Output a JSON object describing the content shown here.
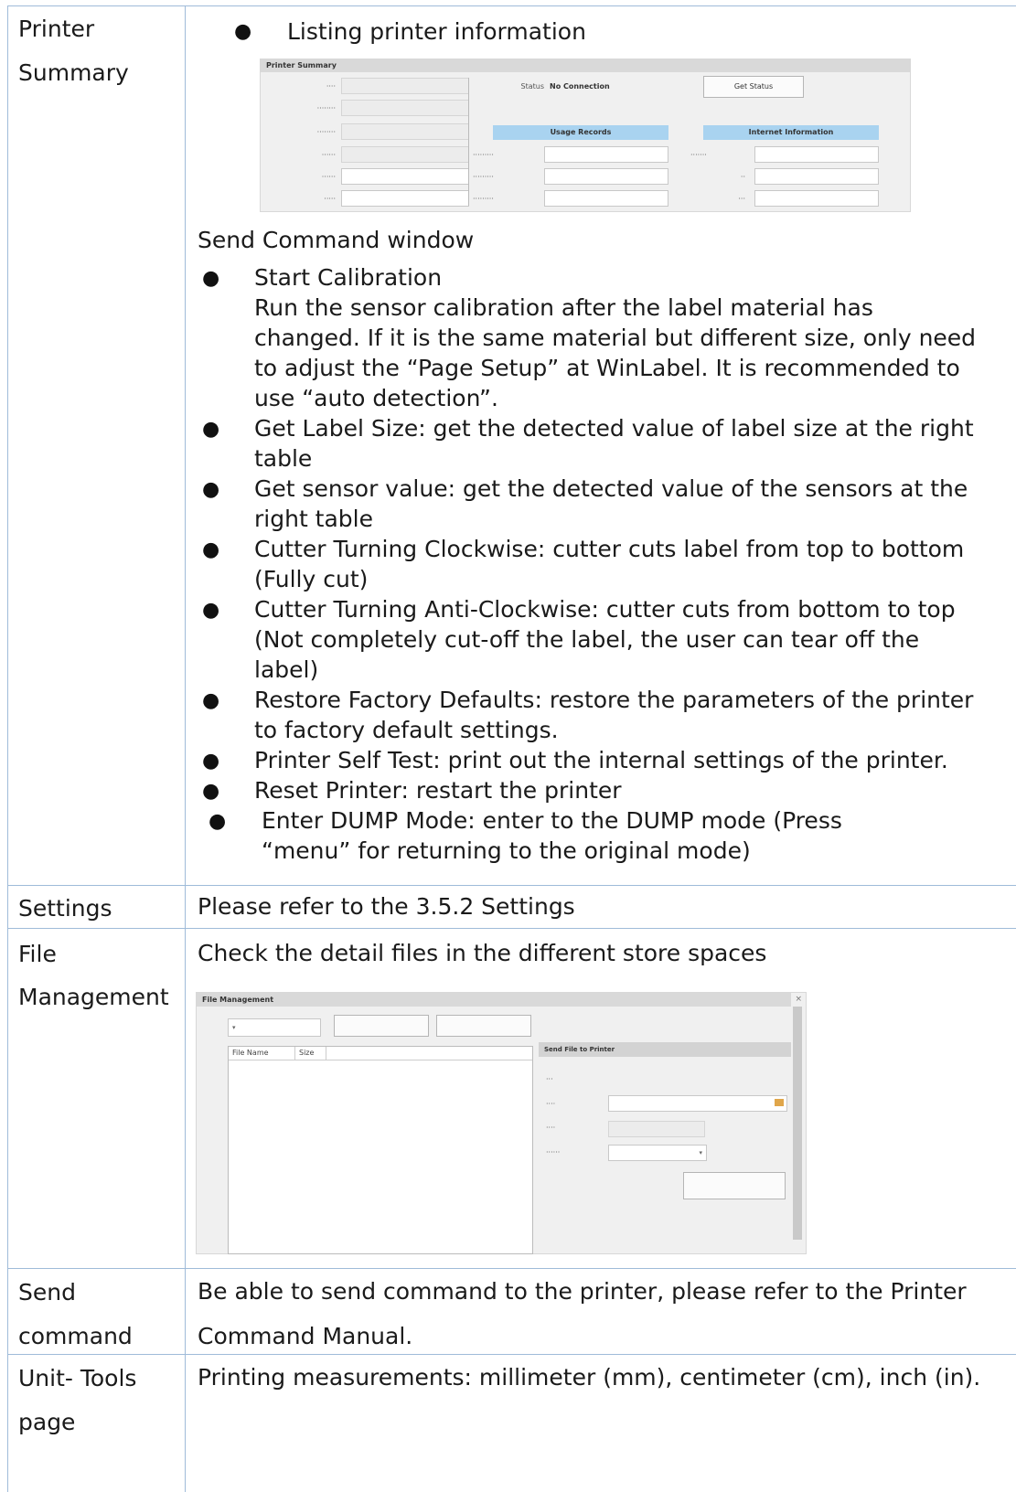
{
  "rows": [
    {
      "label": [
        "Printer",
        "Summary"
      ]
    },
    {
      "label": [
        "Settings"
      ]
    },
    {
      "label": [
        "File",
        "Management"
      ]
    },
    {
      "label": [
        "Send",
        "command"
      ]
    },
    {
      "label": [
        "Unit- Tools",
        "page"
      ]
    }
  ],
  "summary": {
    "bullet_intro": "Listing printer information",
    "send_window_title": "Send Command window",
    "items": [
      {
        "lines": [
          "Start Calibration",
          "Run the sensor calibration after the label material has",
          "changed. If it is the same material but different size, only need",
          "to adjust the “Page Setup” at WinLabel. It is recommended to",
          "use “auto detection”."
        ]
      },
      {
        "lines": [
          "Get Label Size: get the detected value of label size at the right",
          "table"
        ]
      },
      {
        "lines": [
          "Get sensor value: get the detected value of the sensors at the",
          "right table"
        ]
      },
      {
        "lines": [
          "Cutter Turning Clockwise: cutter cuts label from top to bottom",
          "(Fully cut)"
        ]
      },
      {
        "lines": [
          "Cutter Turning Anti-Clockwise: cutter cuts from bottom to top",
          "(Not completely cut-off the label, the user can tear off the",
          "label)"
        ]
      },
      {
        "lines": [
          "Restore Factory Defaults: restore the parameters of the printer",
          "to factory default settings."
        ]
      },
      {
        "lines": [
          "Printer Self Test: print out the internal settings of the printer."
        ]
      },
      {
        "lines": [
          "Reset Printer: restart the printer"
        ]
      },
      {
        "lines": [
          "Enter DUMP Mode: enter to the DUMP mode (Press",
          "“menu” for returning to the original mode)"
        ]
      }
    ]
  },
  "settings_text": "Please refer to the 3.5.2 Settings",
  "file_mgmt_text": "Check the detail files in the different store spaces",
  "send_command_text": [
    "Be able to send command to the printer, please refer to the Printer",
    "Command Manual."
  ],
  "unit_tools_text": "Printing measurements: millimeter (mm), centimeter (cm), inch (in).",
  "shot1": {
    "title": "Printer Summary",
    "status_label": "Status",
    "status_value": "No Connection",
    "get_status_button": "Get Status",
    "usage_records": "Usage Records",
    "internet_info": "Internet Information"
  },
  "shot2": {
    "title": "File Management",
    "send_file_header": "Send File to Printer",
    "col_file_name": "File Name",
    "col_size": "Size"
  }
}
